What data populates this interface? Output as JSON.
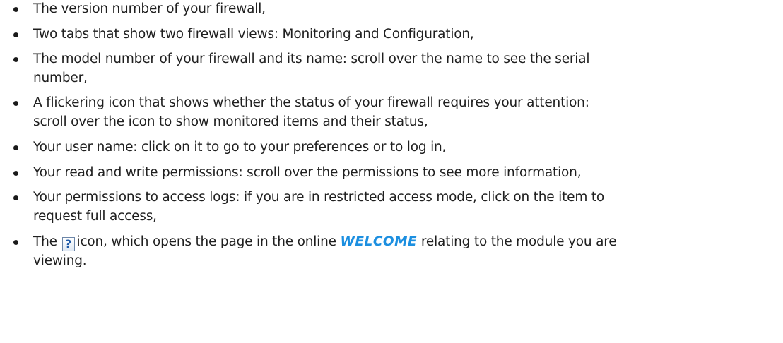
{
  "bullets": [
    {
      "text": "The version number of your firewall,"
    },
    {
      "text": "Two tabs that show two firewall views: Monitoring and Configuration,"
    },
    {
      "line1": "The model number of your firewall and its name: scroll over the name to see the serial",
      "line2": "number,"
    },
    {
      "line1": "A flickering icon that shows whether the status of your firewall requires your attention:",
      "line2": "scroll over the icon to show monitored items and their status,"
    },
    {
      "text": "Your user name: click on it to go to your preferences or to log in,"
    },
    {
      "text": "Your read and write permissions: scroll over the permissions to see more information,"
    },
    {
      "line1": "Your permissions to access logs: if you are in restricted access mode, click on the item to",
      "line2": "request full access,"
    },
    {
      "prefix": "The",
      "icon_glyph": "?",
      "middle": "icon, which opens the page in the online",
      "link": "WELCOME",
      "suffix": "relating to the module you are",
      "line2": "viewing."
    }
  ],
  "colors": {
    "text": "#1f1f1f",
    "link": "#1c8fe0",
    "help_icon_border": "#6c86a8"
  }
}
